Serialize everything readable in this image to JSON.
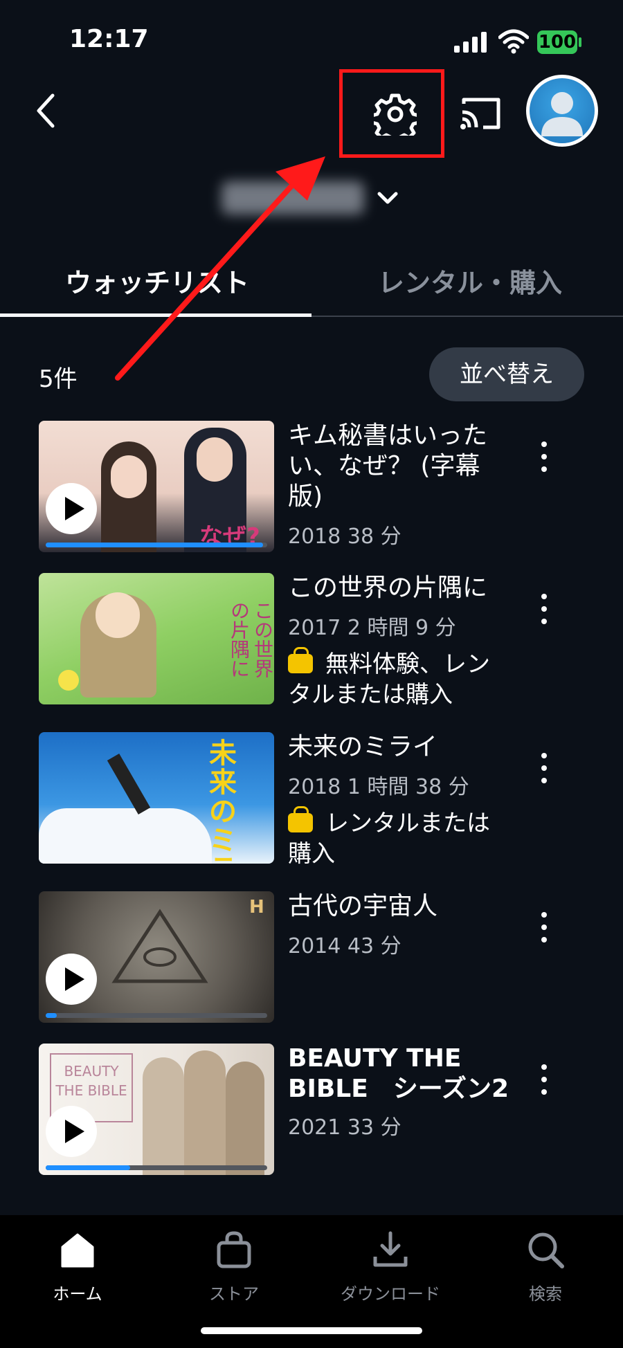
{
  "status_bar": {
    "time": "12:17",
    "battery": "100"
  },
  "tabs": [
    {
      "label": "ウォッチリスト",
      "active": true
    },
    {
      "label": "レンタル・購入",
      "active": false
    }
  ],
  "list": {
    "count": "5件",
    "sort_label": "並べ替え",
    "items": [
      {
        "title": "キム秘書はいったい、なぜ？ (字幕版)",
        "meta": "2018 38 分",
        "badge": "",
        "progress": 0.98
      },
      {
        "title": "この世界の片隅に",
        "meta": "2017 2 時間 9 分",
        "badge": "無料体験、レンタルまたは購入",
        "progress": 0
      },
      {
        "title": "未来のミライ",
        "meta": "2018 1 時間 38 分",
        "badge": "レンタルまたは購入",
        "progress": 0
      },
      {
        "title": "古代の宇宙人",
        "meta": "2014 43 分",
        "badge": "",
        "progress": 0.05
      },
      {
        "title": "BEAUTY THE BIBLE　シーズン2",
        "meta": "2021 33 分",
        "badge": "",
        "progress": 0.38
      }
    ]
  },
  "thumb_text": {
    "kim": "なぜ?",
    "kono": "この世界の片隅に",
    "mirai": "未来のミライ",
    "history": "H",
    "beauty": "BEAUTY THE BIBLE"
  },
  "bottom_nav": [
    {
      "label": "ホーム",
      "icon": "home-icon",
      "active": true
    },
    {
      "label": "ストア",
      "icon": "store-bag-icon",
      "active": false
    },
    {
      "label": "ダウンロード",
      "icon": "download-icon",
      "active": false
    },
    {
      "label": "検索",
      "icon": "search-icon",
      "active": false
    }
  ],
  "colors": {
    "background": "#0b1018",
    "highlight": "#ff1a1a",
    "progress": "#1f8fff",
    "badge": "#f4c400"
  }
}
